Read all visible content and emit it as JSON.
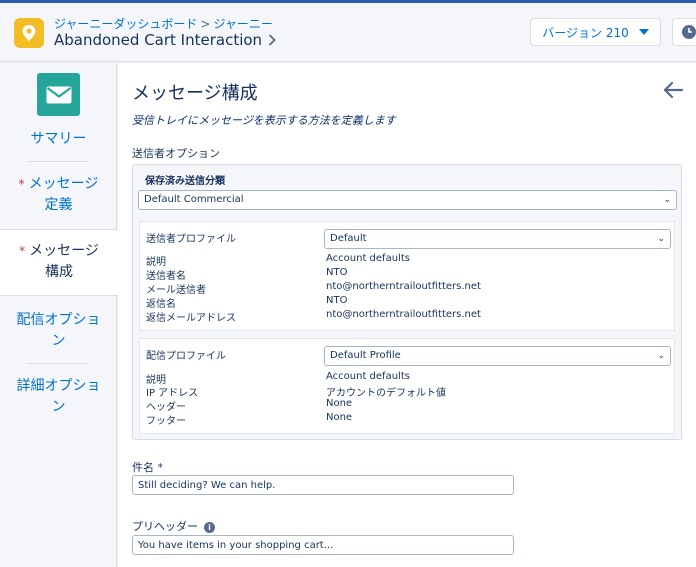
{
  "header": {
    "breadcrumb": [
      "ジャーニーダッシュボード",
      "ジャーニー"
    ],
    "breadcrumb_sep": ">",
    "title": "Abandoned Cart Interaction",
    "version_label": "バージョン 210",
    "app_icon": "location-pin-icon"
  },
  "sidebar": {
    "items": [
      {
        "label": "サマリー",
        "required": false,
        "active": false
      },
      {
        "label": "メッセージ定義",
        "line1": "メッセージ",
        "line2": "定義",
        "required": true,
        "active": false
      },
      {
        "label": "メッセージ構成",
        "line1": "メッセージ",
        "line2": "構成",
        "required": true,
        "active": true
      },
      {
        "label": "配信オプション",
        "line1": "配信オプショ",
        "line2": "ン",
        "required": false,
        "active": false
      },
      {
        "label": "詳細オプション",
        "line1": "詳細オプショ",
        "line2": "ン",
        "required": false,
        "active": false
      }
    ],
    "required_mark": "*"
  },
  "main": {
    "title": "メッセージ構成",
    "subtitle": "受信トレイにメッセージを表示する方法を定義します",
    "sender_options_label": "送信者オプション",
    "saved_classification": {
      "heading": "保存済み送信分類",
      "value": "Default Commercial"
    },
    "sender_profile": {
      "label": "送信者プロファイル",
      "value": "Default",
      "rows": [
        {
          "label": "説明",
          "value": "Account defaults"
        },
        {
          "label": "送信者名",
          "value": "NTO"
        },
        {
          "label": "メール送信者",
          "value": "nto@northerntrailoutfitters.net"
        },
        {
          "label": "返信名",
          "value": "NTO"
        },
        {
          "label": "返信メールアドレス",
          "value": "nto@northerntrailoutfitters.net"
        }
      ]
    },
    "delivery_profile": {
      "label": "配信プロファイル",
      "value": "Default Profile",
      "rows": [
        {
          "label": "説明",
          "value": "Account defaults"
        },
        {
          "label": "IP アドレス",
          "value": "アカウントのデフォルト値"
        },
        {
          "label": "ヘッダー",
          "value": "None"
        },
        {
          "label": "フッター",
          "value": "None"
        }
      ]
    },
    "subject": {
      "label": "件名 *",
      "value": "Still deciding? We can help."
    },
    "preheader": {
      "label": "プリヘッダー",
      "value": "You have items in your shopping cart..."
    }
  },
  "colors": {
    "link": "#0070d2",
    "text": "#16325c",
    "tile": "#26a69a",
    "app_icon": "#f4bc25",
    "required": "#c23934"
  }
}
